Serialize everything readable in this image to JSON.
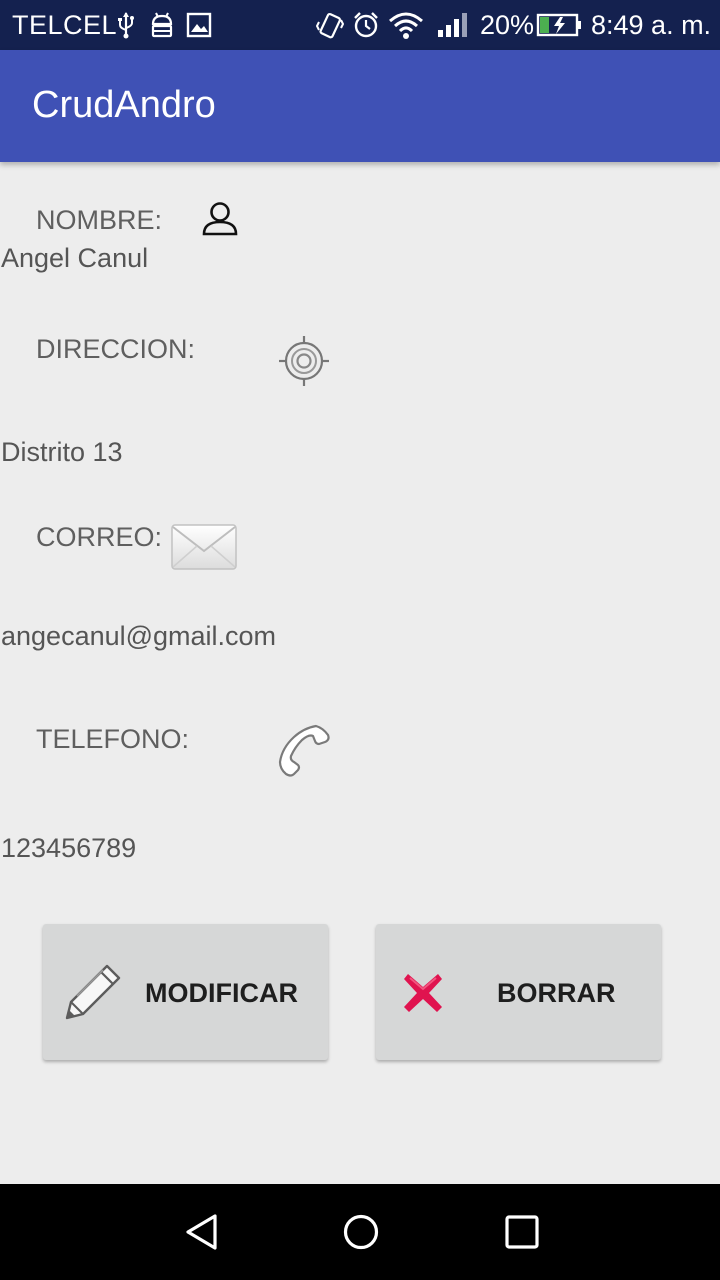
{
  "status_bar": {
    "carrier": "TELCEL",
    "battery_percent": "20%",
    "time": "8:49 a. m.",
    "icons": [
      "usb-icon",
      "android-debug-icon",
      "image-notification-icon",
      "vibrate-icon",
      "alarm-icon",
      "wifi-icon",
      "signal-icon",
      "battery-charging-icon"
    ]
  },
  "app_bar": {
    "title": "CrudAndro",
    "color": "#3f51b5"
  },
  "fields": {
    "nombre": {
      "label": "NOMBRE:",
      "value": "Angel Canul",
      "icon": "person-icon"
    },
    "direccion": {
      "label": "DIRECCION:",
      "value": "Distrito 13",
      "icon": "location-target-icon"
    },
    "correo": {
      "label": "CORREO:",
      "value": "angecanul@gmail.com",
      "icon": "envelope-icon"
    },
    "telefono": {
      "label": "TELEFONO:",
      "value": "123456789",
      "icon": "phone-icon"
    }
  },
  "buttons": {
    "modificar": {
      "label": "MODIFICAR",
      "icon": "pencil-icon"
    },
    "borrar": {
      "label": "BORRAR",
      "icon": "red-x-icon",
      "icon_color": "#e0134f"
    }
  },
  "nav_bar": {
    "icons": [
      "back-icon",
      "home-icon",
      "recents-icon"
    ]
  }
}
